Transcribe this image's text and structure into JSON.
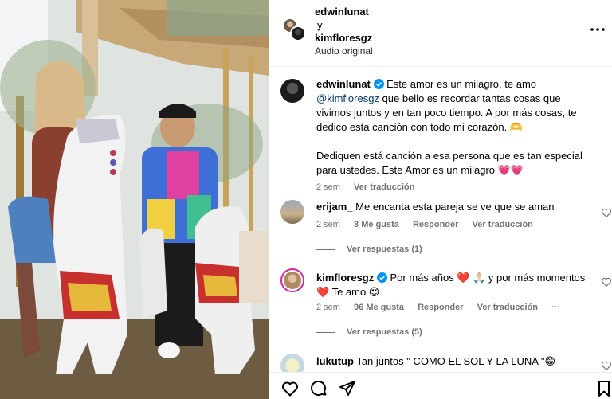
{
  "header": {
    "user1": "edwinlunat",
    "conjunction": "y",
    "user2": "kimfloresgz",
    "audio": "Audio original",
    "more_icon": "more-horizontal-icon"
  },
  "caption": {
    "username": "edwinlunat",
    "part1": "Este amor es un milagro, te amo ",
    "mention": "@kimfloresgz",
    "part2": " que bello es recordar tantas cosas que vivimos juntos y en tan poco tiempo. A por más cosas, te dedico esta canción con todo mi corazón. 🫶",
    "part3": "Dediquen está canción a esa persona que es tan especial para ustedes. Este Amor es un milagro 💗💗",
    "time": "2 sem",
    "translate": "Ver traducción"
  },
  "comments": [
    {
      "username": "erijam_",
      "text": "Me encanta esta pareja se ve que se aman",
      "time": "2 sem",
      "likes": "8 Me gusta",
      "reply": "Responder",
      "translate": "Ver traducción",
      "replies": "Ver respuestas (1)"
    },
    {
      "username": "kimfloresgz",
      "text": "Por más años ❤️ 🙏🏻 y por más momentos ❤️ Te amo 😍",
      "time": "2 sem",
      "likes": "96 Me gusta",
      "reply": "Responder",
      "translate": "Ver traducción",
      "more": "···",
      "replies": "Ver respuestas (5)"
    },
    {
      "username": "lukutup",
      "text": "Tan juntos \" COMO EL SOL Y LA LUNA \"😁"
    }
  ],
  "actions": {
    "like": "heart-icon",
    "comment": "comment-icon",
    "share": "send-icon",
    "save": "bookmark-icon"
  },
  "colors": {
    "mention": "#00376b",
    "secondary": "#737373",
    "verified": "#0095f6"
  }
}
